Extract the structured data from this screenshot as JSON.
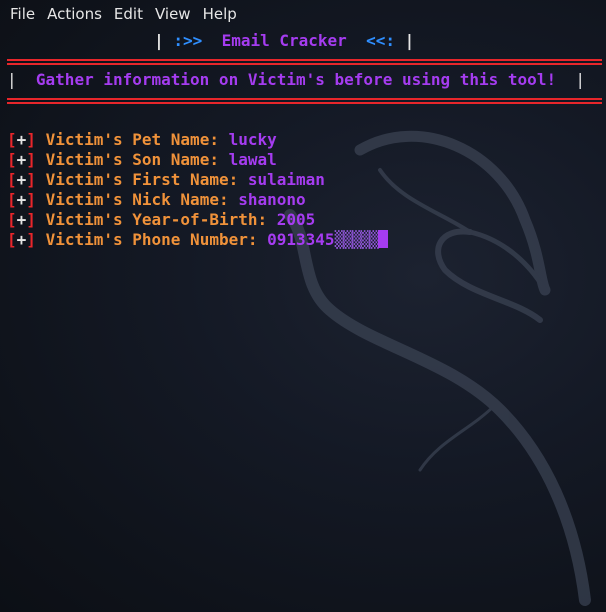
{
  "menu": {
    "items": [
      "File",
      "Actions",
      "Edit",
      "View",
      "Help"
    ]
  },
  "title": {
    "left_pipe": "|",
    "left_arrow": ":>>",
    "text": "Email Cracker",
    "right_arrow": "<<:",
    "right_pipe": "|"
  },
  "banner": {
    "left_pipe": "|",
    "text": "Gather information on Victim's before using this tool!",
    "right_pipe": "|"
  },
  "entries": [
    {
      "marker": "+",
      "label": "Victim's Pet Name:",
      "value": "lucky"
    },
    {
      "marker": "+",
      "label": "Victim's Son Name:",
      "value": "lawal"
    },
    {
      "marker": "+",
      "label": "Victim's First Name:",
      "value": "sulaiman"
    },
    {
      "marker": "+",
      "label": "Victim's Nick Name:",
      "value": "shanono"
    },
    {
      "marker": "+",
      "label": "Victim's Year-of-Birth:",
      "value": "2005"
    },
    {
      "marker": "+",
      "label": "Victim's Phone Number:",
      "value": "0913345"
    }
  ],
  "colors": {
    "rule": "#e8262b",
    "label": "#f0923a",
    "value": "#a53cf0",
    "arrow": "#2f8fff"
  }
}
